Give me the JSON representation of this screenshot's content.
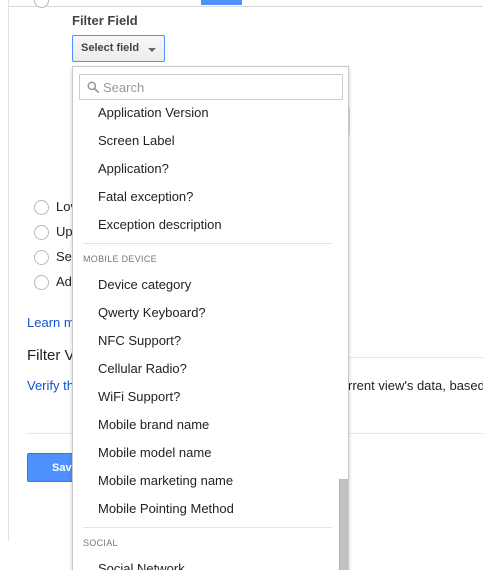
{
  "filter": {
    "field_label": "Filter Field",
    "select_label": "Select field"
  },
  "search": {
    "placeholder": "Search",
    "value": ""
  },
  "dropdown": {
    "items_top": [
      "Application Version",
      "Screen Label",
      "Application?",
      "Fatal exception?",
      "Exception description"
    ],
    "group_mobile": "MOBILE DEVICE",
    "items_mobile": [
      "Device category",
      "Qwerty Keyboard?",
      "NFC Support?",
      "Cellular Radio?",
      "WiFi Support?",
      "Mobile brand name",
      "Mobile model name",
      "Mobile marketing name",
      "Mobile Pointing Method"
    ],
    "group_social": "SOCIAL",
    "items_social": [
      "Social Network"
    ]
  },
  "background": {
    "radio_labels": [
      "Lov",
      "Up",
      "Se",
      "Ad"
    ],
    "learn_more": "Learn m",
    "verification_heading": "Filter V",
    "verify_link": "Verify th",
    "verify_text_right": "rrent view's data, based",
    "save_label": "Save"
  },
  "colors": {
    "accent_blue": "#4d90fe",
    "link_blue": "#1155cc",
    "scrollbar_thumb": "#c1c1c1"
  }
}
